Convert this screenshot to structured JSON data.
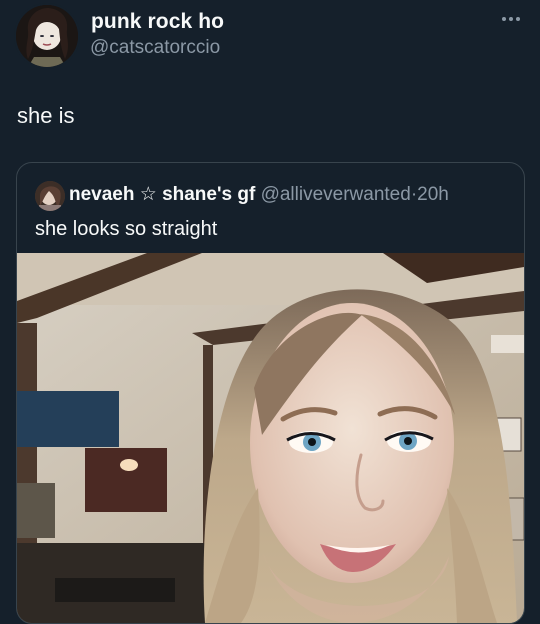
{
  "tweet": {
    "display_name": "punk rock ho",
    "handle": "@catscatorccio",
    "text": "she is",
    "more_icon": "more-horizontal-icon"
  },
  "quoted_tweet": {
    "display_name": "nevaeh ☆ shane's gf",
    "handle": "@alliveverwanted",
    "separator": "·",
    "time": "20h",
    "text": "she looks so straight"
  },
  "colors": {
    "background": "#15202b",
    "text_primary": "#f7f9f9",
    "text_secondary": "#8b98a5",
    "border": "#38444d"
  }
}
